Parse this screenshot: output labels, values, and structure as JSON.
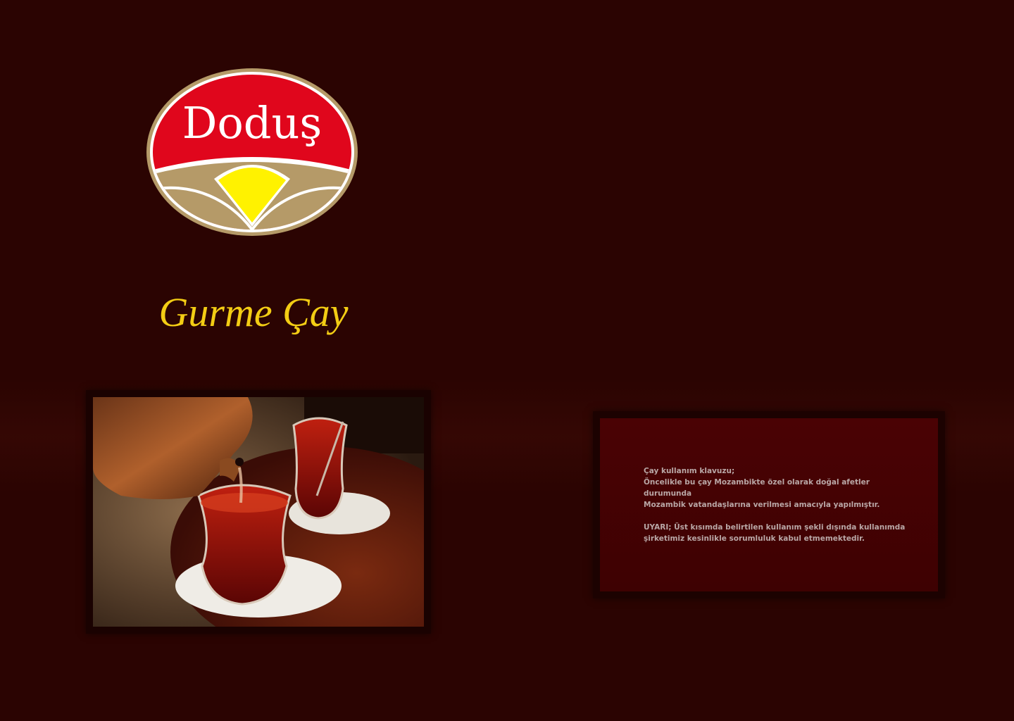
{
  "brand": {
    "logo_text": "Doduş",
    "colors": {
      "logo_red": "#e0061c",
      "logo_gold": "#b59a68",
      "logo_yellow": "#fff200",
      "tagline": "#f3cd14",
      "background": "#2b0402",
      "panel": "#430103"
    }
  },
  "tagline": "Gurme Çay",
  "photo": {
    "subject": "tea-glasses-photo"
  },
  "info": {
    "heading": "Çay kullanım klavuzu;",
    "line1": "Öncelikle bu çay Mozambikte özel olarak doğal afetler durumunda",
    "line2": "Mozambik vatandaşlarına verilmesi amacıyla yapılmıştır.",
    "warning1": "UYARI; Üst kısımda belirtilen kullanım şekli dışında kullanımda",
    "warning2": "şirketimiz kesinlikle sorumluluk kabul etmemektedir."
  }
}
